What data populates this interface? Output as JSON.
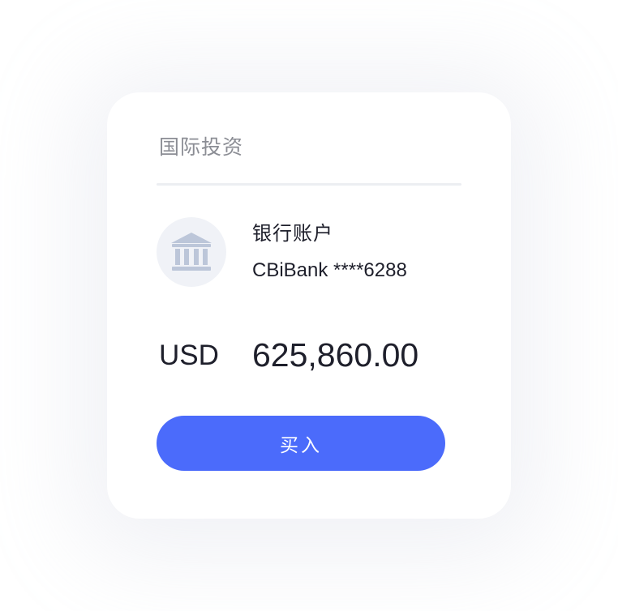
{
  "card": {
    "title": "国际投资"
  },
  "account": {
    "icon": "bank-icon",
    "label": "银行账户",
    "number": "CBiBank ****6288"
  },
  "balance": {
    "currency": "USD",
    "amount": "625,860.00"
  },
  "actions": {
    "buy_label": "买入"
  },
  "colors": {
    "accent": "#4b6bfb",
    "icon": "#bcc6d9",
    "avatar_bg": "#f0f2f7",
    "title_text": "#8b8d94",
    "body_text": "#1e1f2b"
  }
}
